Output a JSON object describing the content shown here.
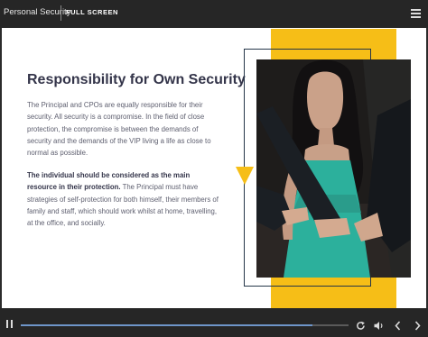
{
  "topbar": {
    "course_title": "Personal Security",
    "fullscreen_label": "FULL SCREEN",
    "menu_icon": "hamburger-menu-icon"
  },
  "slide": {
    "heading": "Responsibility for Own Security",
    "paragraph1": "The Principal and CPOs are equally responsible for their security. All security is a compromise. In the field of close protection, the compromise is between the demands of security and the demands of the VIP living a life as close to normal as possible.",
    "paragraph2_bold": "The individual should be considered as the main resource in their protection.",
    "paragraph2_rest": " The Principal must have strategies of self-protection for both himself, their members of family and staff, which should work whilst at home, travelling, at the office, and socially.",
    "accent_color": "#f6be17",
    "frame_color": "#253649"
  },
  "player": {
    "progress": 0.89,
    "icons": [
      "pause-icon",
      "replay-icon",
      "volume-icon",
      "previous-icon",
      "next-icon"
    ],
    "progress_color": "#6e95c9"
  }
}
